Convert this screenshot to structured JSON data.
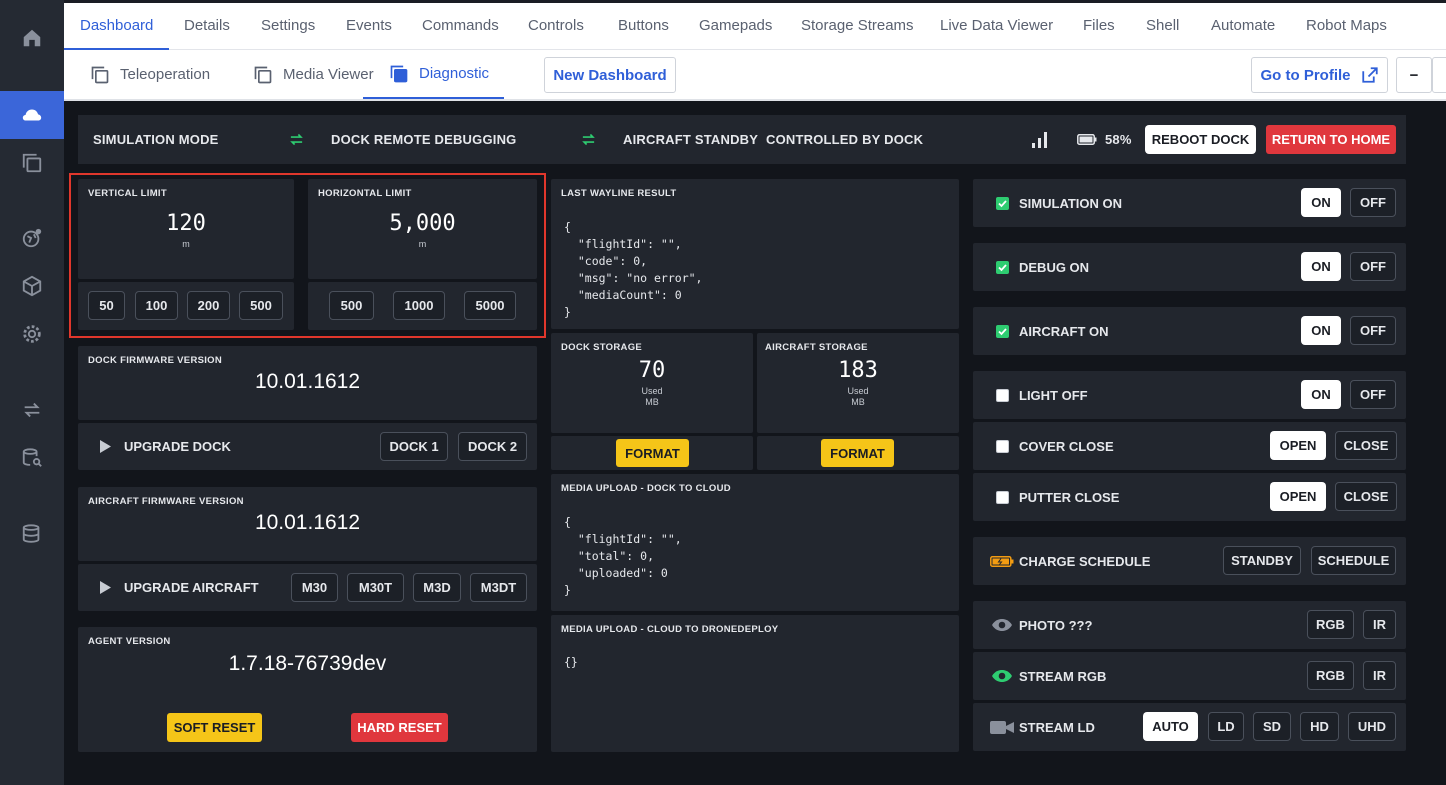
{
  "top_tabs": [
    "Dashboard",
    "Details",
    "Settings",
    "Events",
    "Commands",
    "Controls",
    "Buttons",
    "Gamepads",
    "Storage Streams",
    "Live Data Viewer",
    "Files",
    "Shell",
    "Automate",
    "Robot Maps"
  ],
  "sub_tabs": [
    "Teleoperation",
    "Media Viewer",
    "Diagnostic"
  ],
  "new_dashboard": "New Dashboard",
  "go_to_profile": "Go to Profile",
  "minus": "−",
  "status": {
    "simulation_mode": "SIMULATION MODE",
    "dock_remote_debugging": "DOCK REMOTE DEBUGGING",
    "aircraft_standby": "AIRCRAFT STANDBY",
    "controlled_by_dock": "CONTROLLED BY DOCK",
    "battery": "58%",
    "reboot_dock": "REBOOT DOCK",
    "return_to_home": "RETURN TO HOME",
    "battery_level": 0.58
  },
  "limits": {
    "vertical": {
      "label": "VERTICAL LIMIT",
      "value": "120",
      "unit": "m",
      "buttons": [
        "50",
        "100",
        "200",
        "500"
      ]
    },
    "horizontal": {
      "label": "HORIZONTAL LIMIT",
      "value": "5,000",
      "unit": "m",
      "buttons": [
        "500",
        "1000",
        "5000"
      ]
    }
  },
  "dock_firmware": {
    "label": "DOCK FIRMWARE VERSION",
    "value": "10.01.1612"
  },
  "upgrade_dock": {
    "label": "UPGRADE DOCK",
    "buttons": [
      "DOCK 1",
      "DOCK 2"
    ]
  },
  "aircraft_firmware": {
    "label": "AIRCRAFT FIRMWARE VERSION",
    "value": "10.01.1612"
  },
  "upgrade_aircraft": {
    "label": "UPGRADE AIRCRAFT",
    "buttons": [
      "M30",
      "M30T",
      "M3D",
      "M3DT"
    ]
  },
  "agent_version": {
    "label": "AGENT VERSION",
    "value": "1.7.18-76739dev"
  },
  "soft_reset": "SOFT RESET",
  "hard_reset": "HARD RESET",
  "last_wayline": {
    "label": "LAST WAYLINE RESULT",
    "json": "{\n  \"flightId\": \"\",\n  \"code\": 0,\n  \"msg\": \"no error\",\n  \"mediaCount\": 0\n}"
  },
  "dock_storage": {
    "label": "DOCK STORAGE",
    "value": "70",
    "used": "Used",
    "unit": "MB",
    "format": "FORMAT"
  },
  "aircraft_storage": {
    "label": "AIRCRAFT STORAGE",
    "value": "183",
    "used": "Used",
    "unit": "MB",
    "format": "FORMAT"
  },
  "media_dock_cloud": {
    "label": "MEDIA UPLOAD - DOCK TO CLOUD",
    "json": "{\n  \"flightId\": \"\",\n  \"total\": 0,\n  \"uploaded\": 0\n}"
  },
  "media_cloud_dd": {
    "label": "MEDIA UPLOAD - CLOUD TO DRONEDEPLOY",
    "json": "{}"
  },
  "toggles": [
    {
      "label": "SIMULATION ON",
      "checked": true,
      "on": "ON",
      "off": "OFF"
    },
    {
      "label": "DEBUG ON",
      "checked": true,
      "on": "ON",
      "off": "OFF"
    },
    {
      "label": "AIRCRAFT ON",
      "checked": true,
      "on": "ON",
      "off": "OFF"
    },
    {
      "label": "LIGHT OFF",
      "checked": false,
      "on": "ON",
      "off": "OFF"
    },
    {
      "label": "COVER CLOSE",
      "checked": false,
      "on": "OPEN",
      "off": "CLOSE"
    },
    {
      "label": "PUTTER CLOSE",
      "checked": false,
      "on": "OPEN",
      "off": "CLOSE"
    }
  ],
  "charge": {
    "label": "CHARGE SCHEDULE",
    "buttons": [
      "STANDBY",
      "SCHEDULE"
    ]
  },
  "photo": {
    "label": "PHOTO ???",
    "buttons": [
      "RGB",
      "IR"
    ]
  },
  "stream_rgb": {
    "label": "STREAM RGB",
    "buttons": [
      "RGB",
      "IR"
    ]
  },
  "stream_ld": {
    "label": "STREAM LD",
    "buttons": [
      "AUTO",
      "LD",
      "SD",
      "HD",
      "UHD"
    ]
  },
  "colors": {
    "accent": "#2f5fd8",
    "green": "#2ecc71",
    "yellow": "#f5c518",
    "red": "#e0373d",
    "highlight": "#e0372c"
  }
}
